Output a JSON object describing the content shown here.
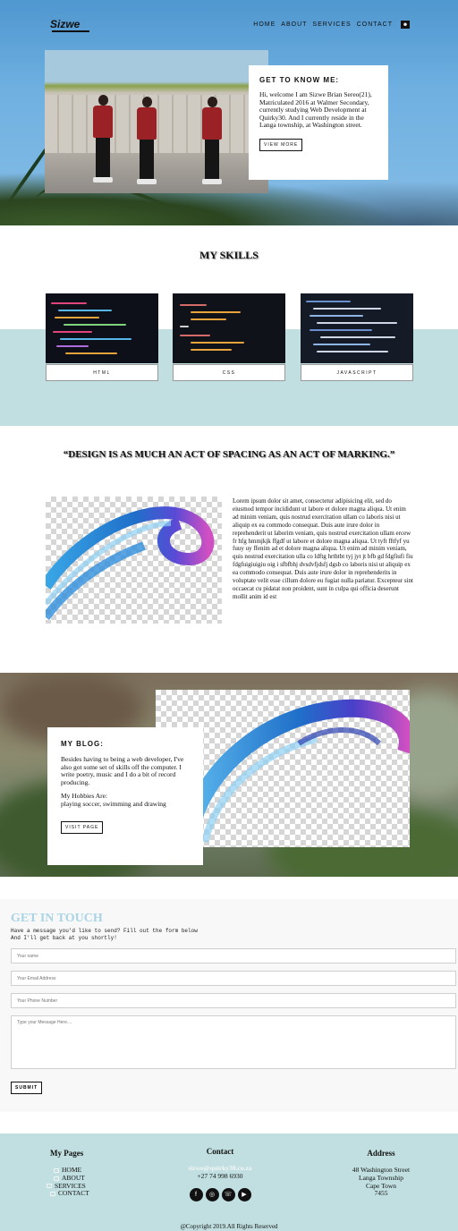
{
  "header": {
    "logo": "Sizwe",
    "nav": [
      "HOME",
      "ABOUT",
      "SERVICES",
      "CONTACT"
    ]
  },
  "about": {
    "title": "GET TO KNOW ME:",
    "text": "Hi, welcome I am Sizwe Brian Sereo(21), Matriculated 2016 at Walmer Secondary, currently studying Web Development at Quirky30. And I currently reside in the Langa township, at Washington street.",
    "button": "VIEW MORE"
  },
  "skills": {
    "title": "MY SKILLS",
    "items": [
      {
        "label": "HTML"
      },
      {
        "label": "CSS"
      },
      {
        "label": "JAVASCRIPT"
      }
    ]
  },
  "quote": "“DESIGN IS AS MUCH AN ACT OF SPACING AS AN ACT OF MARKING.”",
  "lorem": "Lorem ipsum dolor sit amet, consectetur adipisicing elit, sed do eiusmod tempor incididunt ut labore et dolore magna aliqua. Ut enim ad minim veniam, quis nostrud exercitation ullam co laboris nisi ut aliquip ex ea commodo consequat. Duis aute irure dolor in reprehenderit ut laborim veniam, quis nostrud exercitation ullam ercew fr hfg hmmjkjk ffgdf ut labore et dolore magna aliqua. Ut tyft fftfyf yu fuuy uy ffenim ad et dolore magna aliqua. Ut enim ad minim veniam, quis nostrud exercitation ulla co ldftg hrthtbt tyj jyt jt bfb gd fdgfiufi fiu fdgfuigiuigiu oig i sfbfbhj dvsdvfjdsfj dgsb co laboris nisi ut aliquip ex ea commodo consequat. Duis aute irure dolor in reprehenderits in voluptate velit esse cillum dolore eu fugiat nulla pariatur. Excepteur sint occaecat cu pidatat non proident, sunt in culpa qui officia deserunt mollit anim id est",
  "blog": {
    "title": "MY BLOG:",
    "text": "Besides having to being a web developer, I've also got some set of skills off the computer. I write poetry, music and I do a bit of record producing.",
    "hobbies_title": "My Hobbies Are:",
    "hobbies": "playing soccer, swimming and drawing",
    "button": "VISIT PAGE"
  },
  "contact": {
    "title": "GET IN TOUCH",
    "subtitle": "Have a message you'd like to send? Fill out the form below\nAnd I'll get back at you shortly!",
    "name_placeholder": "Your name",
    "email_placeholder": "Your Email Address",
    "phone_placeholder": "Your Phone Number",
    "message_placeholder": "Type your Message Here....",
    "submit": "SUBMIT"
  },
  "footer": {
    "pages_title": "My Pages",
    "pages": [
      "HOME",
      "ABOUT",
      "SERVICES",
      "CONTACT"
    ],
    "contact_title": "Contact",
    "email": "sizwe@quirky30.co.za",
    "phone": "+27 74 998 6930",
    "socials": [
      "facebook-icon",
      "instagram-icon",
      "whatsapp-icon",
      "youtube-icon"
    ],
    "address_title": "Address",
    "address": [
      "48 Washington Street",
      "Langa Township",
      "Cape Town",
      "7455"
    ],
    "copyright": "@Copyright 2019.All Rights Reserved"
  }
}
